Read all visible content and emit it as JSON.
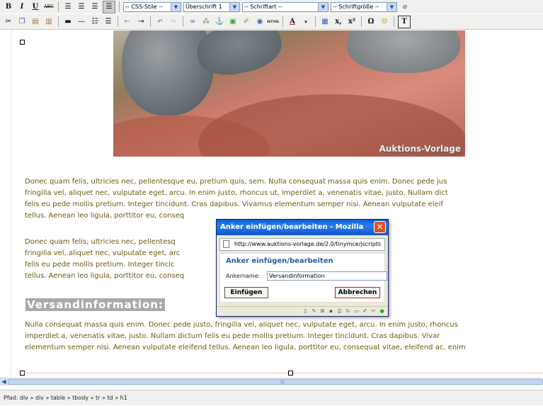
{
  "toolbar1": {
    "bold": "B",
    "italic": "I",
    "underline": "U",
    "strike": "ABC",
    "css_style_select": "-- CSS-Stile --",
    "heading_select": "Überschrift 1",
    "font_select": "-- Schriftart --",
    "size_select": "-- Schriftgröße --"
  },
  "toolbar2": {
    "html_label": "HTML",
    "omega": "Ω",
    "sub": "x,",
    "sup": "x²"
  },
  "image": {
    "watermark": "Auktions-Vorlage"
  },
  "content": {
    "para1": [
      "Donec quam felis, ultricies nec, pellentesque eu, pretium quis, sem. Nulla consequat massa quis enim. Donec pede jus",
      "fringilla vel, aliquet nec, vulputate eget, arcu. In enim justo, rhoncus ut, imperdiet a, venenatis vitae, justo. Nullam dict",
      "felis eu pede mollis pretium. Integer tincidunt. Cras dapibus. Vivamus elementum semper nisi. Aenean vulputate eleif",
      "tellus. Aenean leo ligula, porttitor eu, conseq"
    ],
    "para2": [
      "Donec quam felis, ultricies nec, pellentesq                                    assa quis enim. Donec pede jus",
      "fringilla vel, aliquet nec, vulputate eget, arc                                   enatis vitae, justo. Nullam dict",
      "felis eu pede mollis pretium. Integer tincic                                    er nisi. Aenean vulputate eleif",
      "tellus. Aenean leo ligula, porttitor eu, conseq"
    ],
    "heading": "Versandinformation:",
    "para3": [
      "Nulla consequat massa quis enim. Donec pede justo, fringilla vel, aliquet nec, vulputate eget, arcu. In enim justo, rhoncus",
      "imperdiet a, venenatis vitae, justo. Nullam dictum felis eu pede mollis pretium. Integer tincidunt. Cras dapibus. Vivar",
      "elementum semper nisi. Aenean vulputate eleifend tellus. Aenean leo ligula, porttitor eu, consequat vitae, eleifend ac, enim"
    ]
  },
  "statusbar": {
    "path": "Pfad: div » div » table » tbody » tr » td » h1"
  },
  "dialog": {
    "title": "Anker einfügen/bearbeiten - Mozilla Firefox",
    "close": "✕",
    "url": "http://www.auktions-vorlage.de/2.0/tinymce/jscripts",
    "heading": "Anker einfügen/bearbeiten",
    "anchor_label": "Ankername:",
    "anchor_value": "Versandinformation",
    "insert_button": "Einfügen",
    "cancel_button": "Abbrechen"
  }
}
